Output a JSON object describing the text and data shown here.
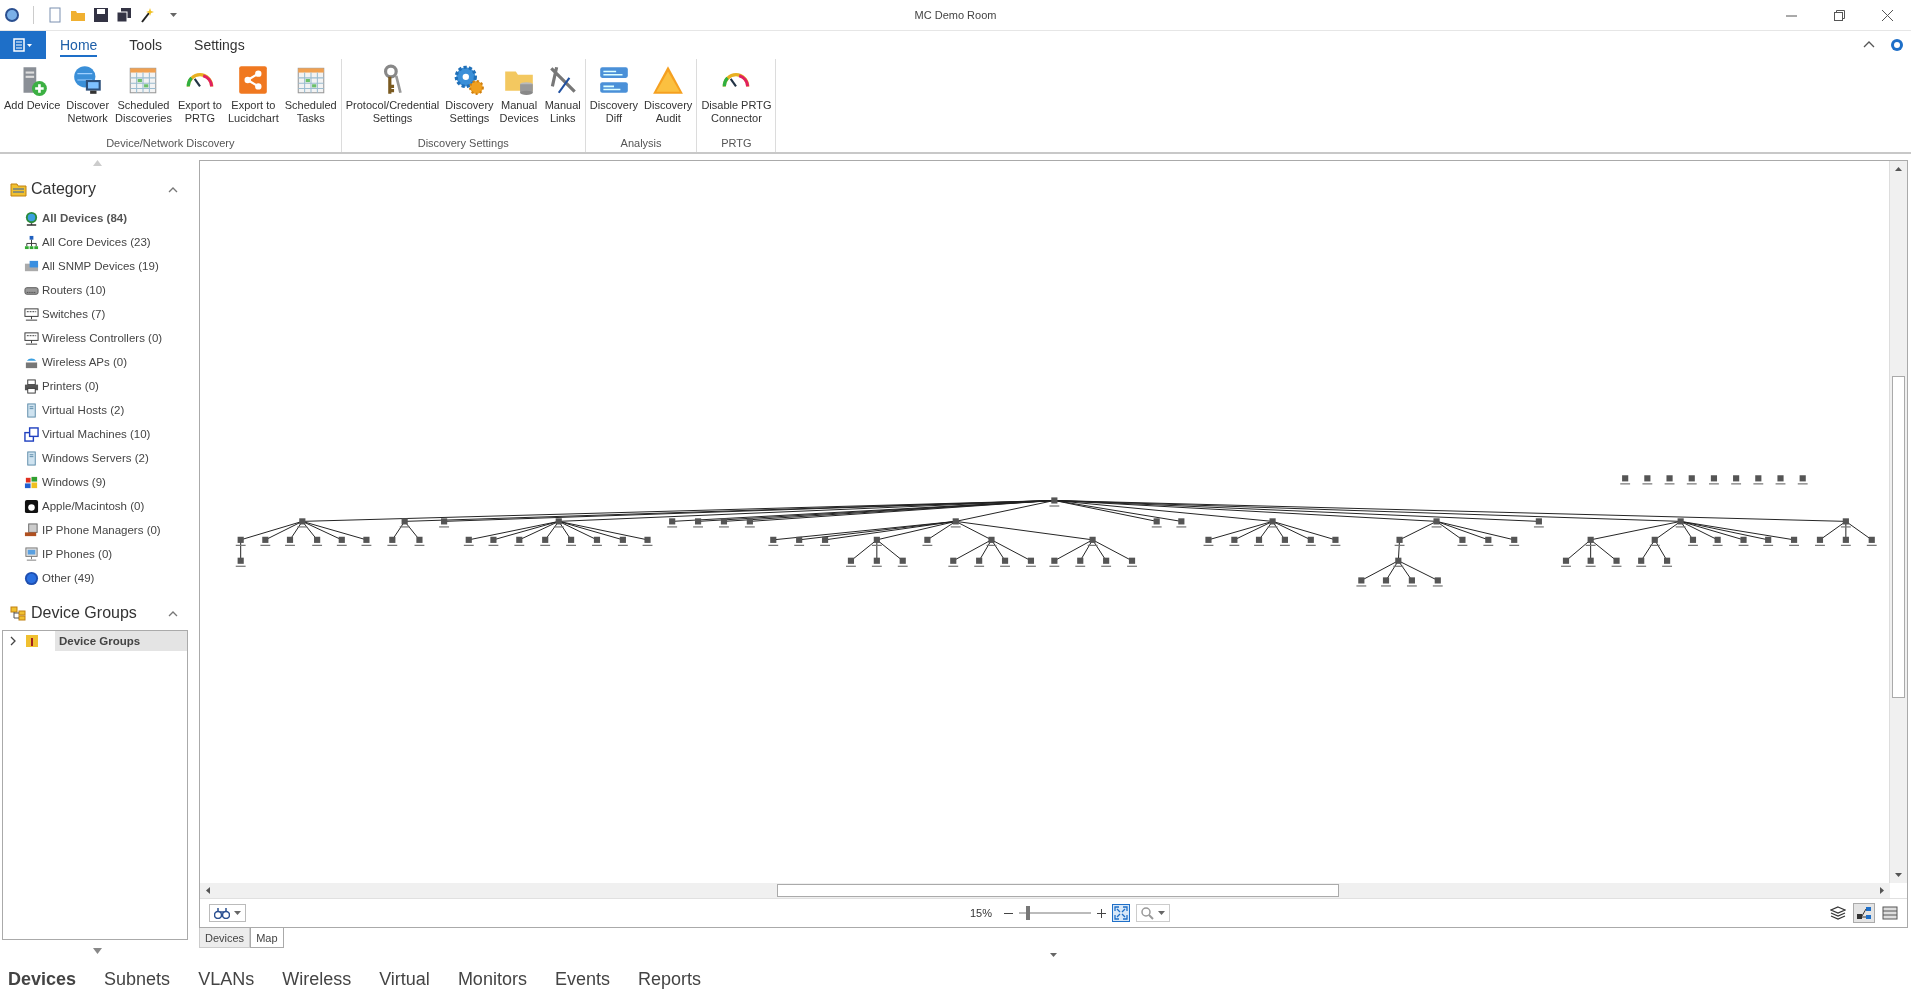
{
  "window": {
    "title": "MC Demo Room"
  },
  "ribbon": {
    "tabs": [
      {
        "label": "Home",
        "selected": true
      },
      {
        "label": "Tools",
        "selected": false
      },
      {
        "label": "Settings",
        "selected": false
      }
    ],
    "groups": [
      {
        "label": "Device/Network Discovery",
        "buttons": [
          {
            "label": "Add Device",
            "kind": "server"
          },
          {
            "label": "Discover\nNetwork",
            "kind": "network"
          },
          {
            "label": "Scheduled\nDiscoveries",
            "kind": "calendar"
          },
          {
            "label": "Export to\nPRTG",
            "kind": "gauge"
          },
          {
            "label": "Export to\nLucidchart",
            "kind": "share"
          },
          {
            "label": "Scheduled\nTasks",
            "kind": "calendar"
          }
        ]
      },
      {
        "label": "Discovery Settings",
        "buttons": [
          {
            "label": "Protocol/Credential\nSettings",
            "kind": "keys"
          },
          {
            "label": "Discovery\nSettings",
            "kind": "gears"
          },
          {
            "label": "Manual\nDevices",
            "kind": "folder"
          },
          {
            "label": "Manual\nLinks",
            "kind": "cable"
          }
        ]
      },
      {
        "label": "Analysis",
        "buttons": [
          {
            "label": "Discovery\nDiff",
            "kind": "diff"
          },
          {
            "label": "Discovery\nAudit",
            "kind": "warning"
          }
        ]
      },
      {
        "label": "PRTG",
        "buttons": [
          {
            "label": "Disable PRTG\nConnector",
            "kind": "gauge"
          }
        ]
      }
    ]
  },
  "sidebar": {
    "category_title": "Category",
    "categories": [
      {
        "label": "All Devices (84)",
        "kind": "globe",
        "selected": true
      },
      {
        "label": "All Core Devices (23)",
        "kind": "core",
        "selected": false
      },
      {
        "label": "All SNMP Devices (19)",
        "kind": "snmp",
        "selected": false
      },
      {
        "label": "Routers (10)",
        "kind": "router",
        "selected": false
      },
      {
        "label": "Switches (7)",
        "kind": "switch",
        "selected": false
      },
      {
        "label": "Wireless Controllers (0)",
        "kind": "switch",
        "selected": false
      },
      {
        "label": "Wireless APs (0)",
        "kind": "ap",
        "selected": false
      },
      {
        "label": "Printers (0)",
        "kind": "printer",
        "selected": false
      },
      {
        "label": "Virtual Hosts (2)",
        "kind": "host",
        "selected": false
      },
      {
        "label": "Virtual Machines (10)",
        "kind": "vm",
        "selected": false
      },
      {
        "label": "Windows Servers (2)",
        "kind": "host",
        "selected": false
      },
      {
        "label": "Windows (9)",
        "kind": "windows",
        "selected": false
      },
      {
        "label": "Apple/Macintosh (0)",
        "kind": "apple",
        "selected": false
      },
      {
        "label": "IP Phone Managers (0)",
        "kind": "phonemgr",
        "selected": false
      },
      {
        "label": "IP Phones (0)",
        "kind": "phone",
        "selected": false
      },
      {
        "label": "Other (49)",
        "kind": "other",
        "selected": false
      }
    ],
    "groups_title": "Device Groups",
    "groups": [
      {
        "label": "Device Groups",
        "expanded": false,
        "selected": true
      }
    ]
  },
  "map": {
    "zoom": "15%",
    "zoom_level": {
      "level": 0.1
    },
    "view_tabs": [
      {
        "label": "Devices",
        "selected": false
      },
      {
        "label": "Map",
        "selected": true
      }
    ]
  },
  "bottom_nav": [
    {
      "label": "Devices",
      "selected": true
    },
    {
      "label": "Subnets",
      "selected": false
    },
    {
      "label": "VLANs",
      "selected": false
    },
    {
      "label": "Wireless",
      "selected": false
    },
    {
      "label": "Virtual",
      "selected": false
    },
    {
      "label": "Monitors",
      "selected": false
    },
    {
      "label": "Events",
      "selected": false
    },
    {
      "label": "Reports",
      "selected": false
    }
  ]
}
